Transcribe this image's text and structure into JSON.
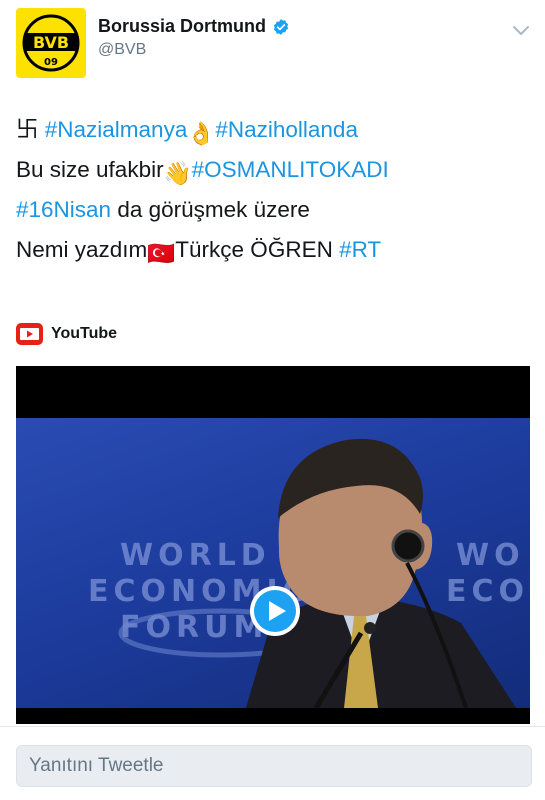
{
  "tweet": {
    "display_name": "Borussia Dortmund",
    "handle": "@BVB",
    "avatar_text": "BVB 09",
    "lines": [
      [
        {
          "text": "卐 ",
          "type": "text"
        },
        {
          "text": "#Nazialmanya",
          "type": "hashtag"
        },
        {
          "text": "👌",
          "type": "emoji"
        },
        {
          "text": "#Nazihollanda",
          "type": "hashtag"
        }
      ],
      [
        {
          "text": "Bu size ufakbir",
          "type": "text"
        },
        {
          "text": "👋",
          "type": "emoji"
        },
        {
          "text": "#OSMANLITOKADI",
          "type": "hashtag"
        }
      ],
      [
        {
          "text": "#16Nisan",
          "type": "hashtag"
        },
        {
          "text": " da görüşmek üzere",
          "type": "text"
        }
      ],
      [
        {
          "text": "Nemi yazdım",
          "type": "text"
        },
        {
          "text": "🇹🇷",
          "type": "emoji"
        },
        {
          "text": "Türkçe ÖĞREN ",
          "type": "text"
        },
        {
          "text": "#RT",
          "type": "hashtag"
        }
      ]
    ]
  },
  "media": {
    "source_label": "YouTube",
    "video_overlay_text": [
      "WORLD",
      "ECONOMIC",
      "FORUM"
    ],
    "video_overlay_text_right": [
      "WO",
      "ECON"
    ]
  },
  "reply": {
    "placeholder": "Yanıtını Tweetle"
  },
  "colors": {
    "hashtag": "#1b95e0",
    "verified": "#1da1f2",
    "avatar_bg": "#fde100",
    "youtube_red": "#e62117"
  },
  "icons": [
    "verified-badge-icon",
    "chevron-down-icon",
    "youtube-logo-icon",
    "play-icon"
  ]
}
